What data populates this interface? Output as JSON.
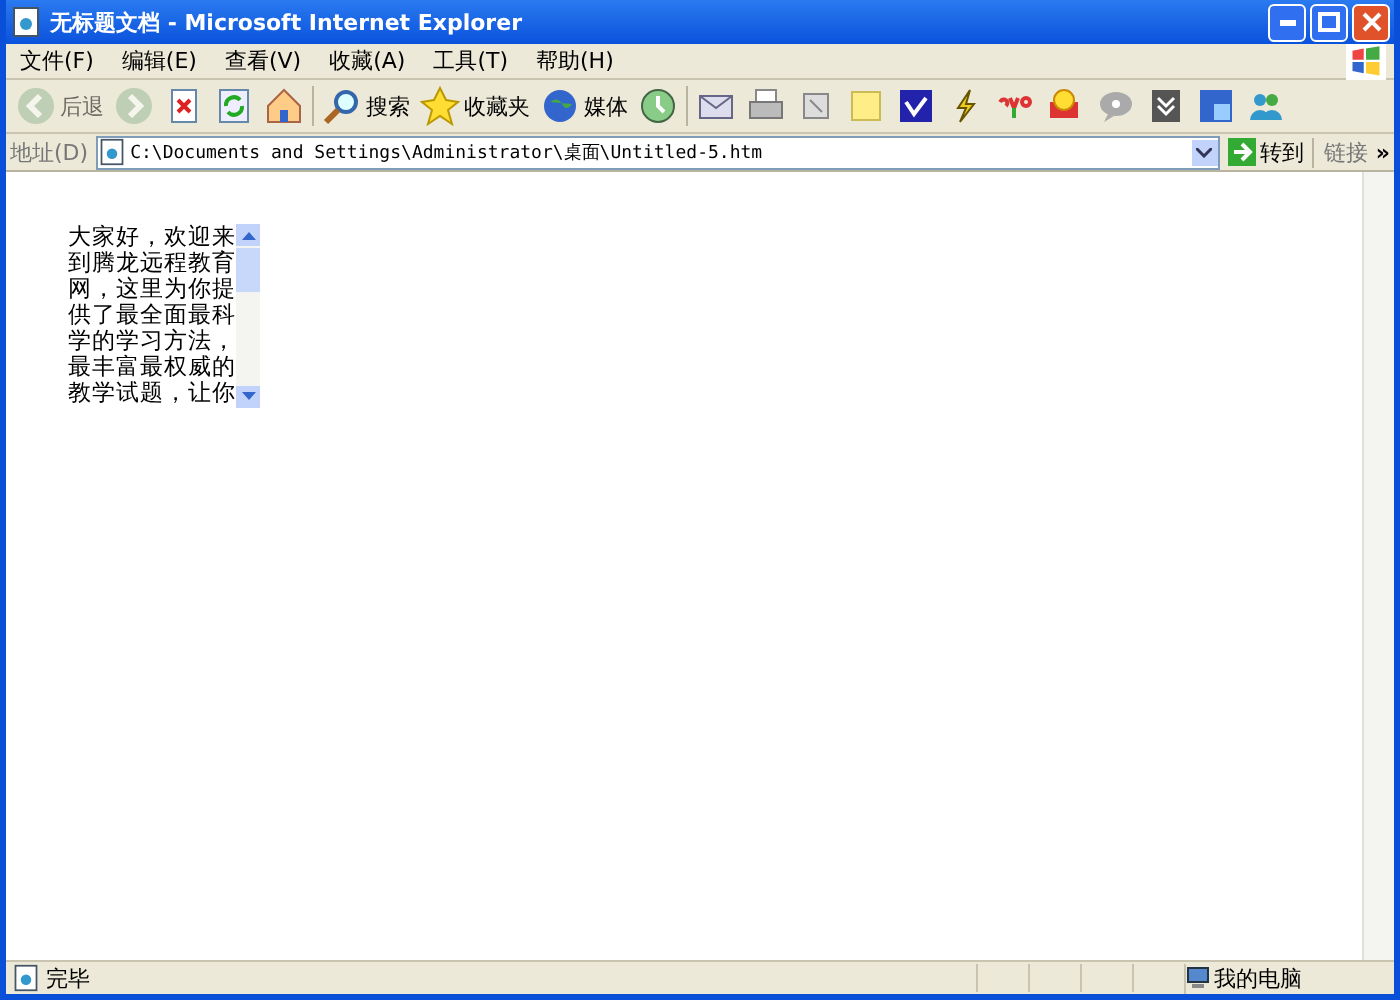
{
  "window": {
    "title": "无标题文档 - Microsoft Internet Explorer"
  },
  "menu": [
    "文件(F)",
    "编辑(E)",
    "查看(V)",
    "收藏(A)",
    "工具(T)",
    "帮助(H)"
  ],
  "toolbar": [
    {
      "kind": "back",
      "label": "后退",
      "disabled": true
    },
    {
      "kind": "forward",
      "disabled": true
    },
    {
      "kind": "stop"
    },
    {
      "kind": "refresh"
    },
    {
      "kind": "home"
    },
    {
      "kind": "search",
      "label": "搜索"
    },
    {
      "kind": "favorites",
      "label": "收藏夹"
    },
    {
      "kind": "media",
      "label": "媒体"
    },
    {
      "kind": "history"
    },
    {
      "kind": "mail"
    },
    {
      "kind": "print"
    },
    {
      "kind": "edit"
    },
    {
      "kind": "note"
    },
    {
      "kind": "check"
    },
    {
      "kind": "bolt"
    },
    {
      "kind": "cyo"
    },
    {
      "kind": "search2"
    },
    {
      "kind": "chat"
    },
    {
      "kind": "down"
    },
    {
      "kind": "ie"
    },
    {
      "kind": "people"
    }
  ],
  "address": {
    "label": "地址(D)",
    "value": "C:\\Documents and Settings\\Administrator\\桌面\\Untitled-5.htm",
    "go": "转到",
    "links": "链接",
    "more": "»"
  },
  "content": {
    "text": "大家好，欢迎来到腾龙远程教育网，这里为你提供了最全面最科学的学习方法，最丰富最权威的教学试题，让你"
  },
  "status_bar": {
    "text": "完毕",
    "zone": "我的电脑"
  }
}
